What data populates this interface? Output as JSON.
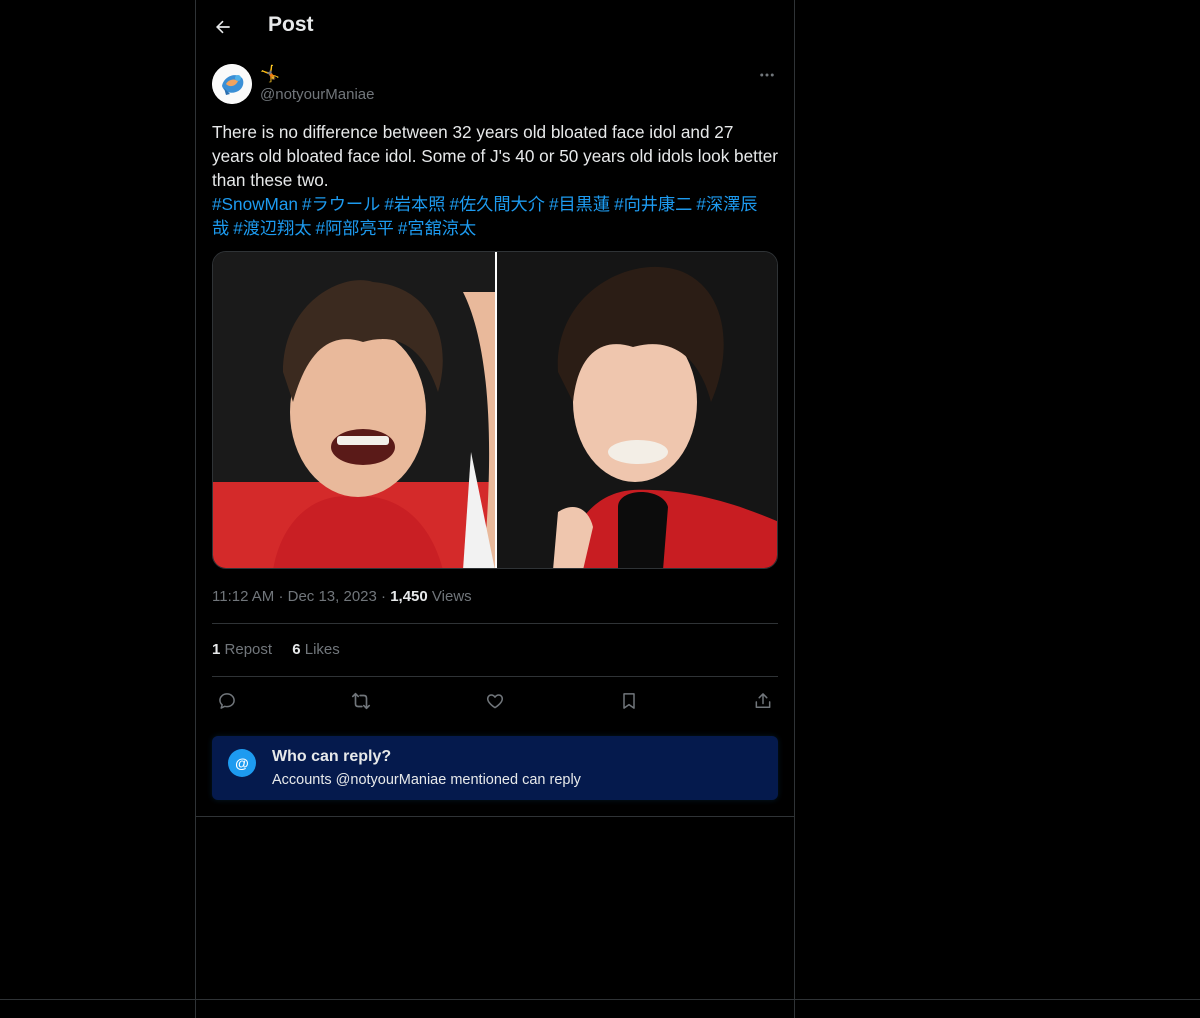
{
  "header": {
    "title": "Post",
    "back_icon": "arrow-left-icon"
  },
  "author": {
    "display_name": "🤸",
    "handle": "@notyourManiae",
    "more_icon": "more-horizontal-icon"
  },
  "post": {
    "text": "There is no difference between 32 years old bloated face idol and 27 years old bloated face idol. Some of J's 40 or 50 years old idols look better than these two.",
    "hashtags": [
      "#SnowMan",
      "#ラウール",
      "#岩本照",
      "#佐久間大介",
      "#目黒蓮",
      "#向井康二",
      "#深澤辰哉",
      "#渡辺翔太",
      "#阿部亮平",
      "#宮舘涼太"
    ]
  },
  "meta": {
    "time": "11:12 AM",
    "date": "Dec 13, 2023",
    "views_count": "1,450",
    "views_label": "Views"
  },
  "counts": {
    "reposts_count": "1",
    "reposts_label": "Repost",
    "likes_count": "6",
    "likes_label": "Likes"
  },
  "actions": [
    "reply-icon",
    "repost-icon",
    "like-icon",
    "bookmark-icon",
    "share-icon"
  ],
  "reply_settings": {
    "icon_glyph": "@",
    "title": "Who can reply?",
    "subtitle": "Accounts @notyourManiae mentioned can reply"
  },
  "colors": {
    "accent": "#1d9bf0",
    "background": "#000000",
    "muted": "#71767b",
    "banner": "#051a4d"
  }
}
